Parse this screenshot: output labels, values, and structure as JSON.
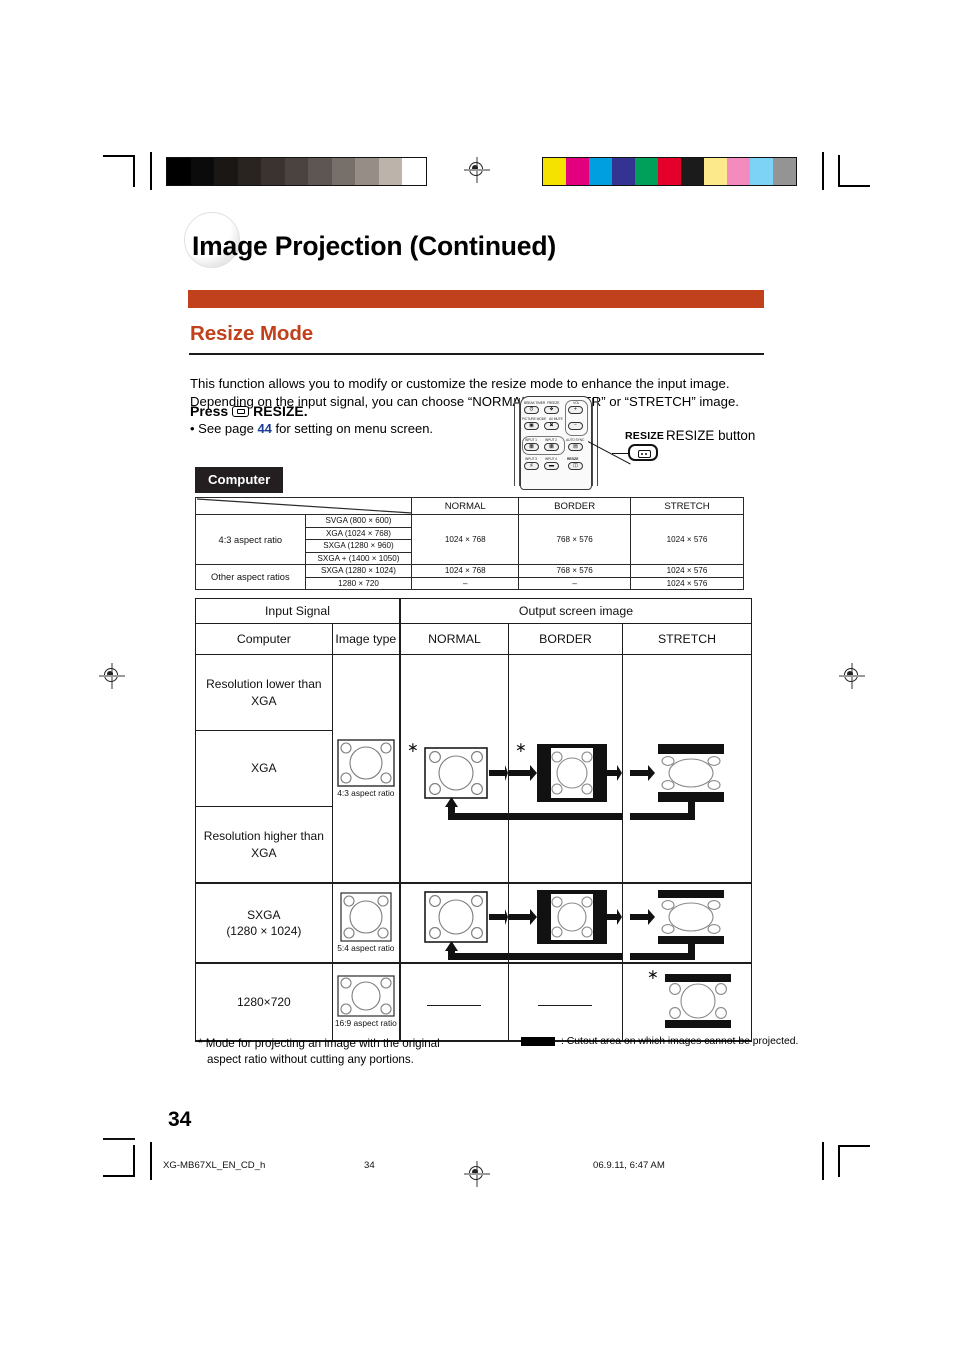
{
  "document": {
    "title": "Image Projection (Continued)",
    "section_title": "Resize Mode",
    "intro": "This function allows you to modify or customize the resize mode to enhance the input image. Depending on the input signal, you can choose “NORMAL”, “BORDER” or “STRETCH” image.",
    "press_label": "Press",
    "press_key": "RESIZE.",
    "see_page_pre": "• See page ",
    "see_page_num": "44",
    "see_page_post": " for setting on menu screen.",
    "source_badge": "Computer",
    "page_number": "34",
    "accent_color": "#c0411b"
  },
  "callout": {
    "key_label": "RESIZE",
    "label": "RESIZE button"
  },
  "remote": {
    "buttons": [
      "BREAK TIMER",
      "FREEZE",
      "VOL",
      "PICTURE MODE",
      "AV MUTE",
      "INPUT 1",
      "INPUT 2",
      "AUTO SYNC",
      "INPUT 3",
      "INPUT 4",
      "RESIZE"
    ],
    "vol_plus": "+",
    "vol_minus": "−"
  },
  "resolution_table": {
    "columns": [
      "NORMAL",
      "BORDER",
      "STRETCH"
    ],
    "groups": [
      {
        "aspect": "4:3 aspect ratio",
        "resolutions": [
          "SVGA (800 × 600)",
          "XGA (1024 × 768)",
          "SXGA (1280 × 960)",
          "SXGA + (1400 × 1050)"
        ],
        "normal": "1024 × 768",
        "border": "768 × 576",
        "stretch": "1024 × 576"
      },
      {
        "aspect": "Other aspect ratios",
        "rows": [
          {
            "resolution": "SXGA (1280 × 1024)",
            "normal": "1024 × 768",
            "border": "768 × 576",
            "stretch": "1024 × 576"
          },
          {
            "resolution": "1280 × 720",
            "normal": "–",
            "border": "–",
            "stretch": "1024 × 576"
          }
        ]
      }
    ]
  },
  "output_table": {
    "header_input": "Input Signal",
    "header_output": "Output screen image",
    "col_computer": "Computer",
    "col_imagetype": "Image type",
    "col_normal": "NORMAL",
    "col_border": "BORDER",
    "col_stretch": "STRETCH",
    "rows": [
      {
        "signal": "Resolution lower than XGA",
        "image_type": "",
        "ratio_caption": ""
      },
      {
        "signal": "XGA",
        "image_type": "4:3",
        "ratio_caption": "4:3 aspect ratio"
      },
      {
        "signal": "Resolution higher than XGA",
        "image_type": "",
        "ratio_caption": ""
      },
      {
        "signal": "SXGA",
        "signal_sub": "(1280 × 1024)",
        "image_type": "5:4",
        "ratio_caption": "5:4 aspect ratio"
      },
      {
        "signal": "1280×720",
        "image_type": "16:9",
        "ratio_caption": "16:9 aspect ratio"
      }
    ],
    "asterisks": {
      "xga_normal": "∗",
      "xga_border": "∗",
      "w720_stretch": "∗"
    },
    "dash_marks": {
      "normal": "",
      "border": ""
    }
  },
  "footnotes": {
    "asterisk_note_line1": "* Mode for projecting an image with the original",
    "asterisk_note_line2": "aspect ratio without cutting any portions.",
    "legend_text": ": Cutout area on which images cannot be projected."
  },
  "print_footer": {
    "file": "XG-MB67XL_EN_CD_h",
    "page": "34",
    "date": "06.9.11, 6:47 AM"
  },
  "color_strips": {
    "gray": [
      "#000000",
      "#0b0b0b",
      "#1a1714",
      "#2a2421",
      "#3a3330",
      "#4a4340",
      "#5d5652",
      "#77706a",
      "#968e86",
      "#bcb3aa",
      "#ffffff"
    ],
    "color": [
      "#f5e200",
      "#e3007f",
      "#00a0e0",
      "#343391",
      "#00a martin",
      "#e4002b",
      "#1b1b1b",
      "#fbe98b",
      "#f48bbf",
      "#7dd3f5",
      "#949494"
    ]
  }
}
